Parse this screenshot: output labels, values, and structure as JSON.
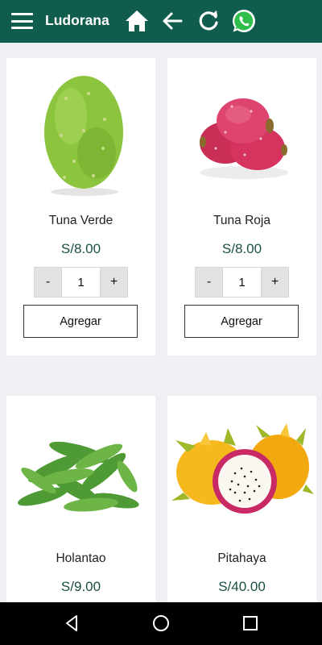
{
  "app_bar": {
    "title": "Ludorana",
    "icons": [
      "menu-icon",
      "home-icon",
      "back-arrow-icon",
      "refresh-icon",
      "whatsapp-icon"
    ],
    "background_color": "#105d4e"
  },
  "products": [
    {
      "name": "Tuna Verde",
      "price": "S/8.00",
      "quantity": "1",
      "minus_label": "-",
      "plus_label": "+",
      "add_label": "Agregar"
    },
    {
      "name": "Tuna Roja",
      "price": "S/8.00",
      "quantity": "1",
      "minus_label": "-",
      "plus_label": "+",
      "add_label": "Agregar"
    },
    {
      "name": "Holantao",
      "price": "S/9.00"
    },
    {
      "name": "Pitahaya",
      "price": "S/40.00"
    }
  ],
  "colors": {
    "price": "#1b4f45",
    "nav_bar": "#000000"
  },
  "nav": {
    "icons": [
      "nav-back-icon",
      "nav-home-icon",
      "nav-recent-icon"
    ]
  }
}
